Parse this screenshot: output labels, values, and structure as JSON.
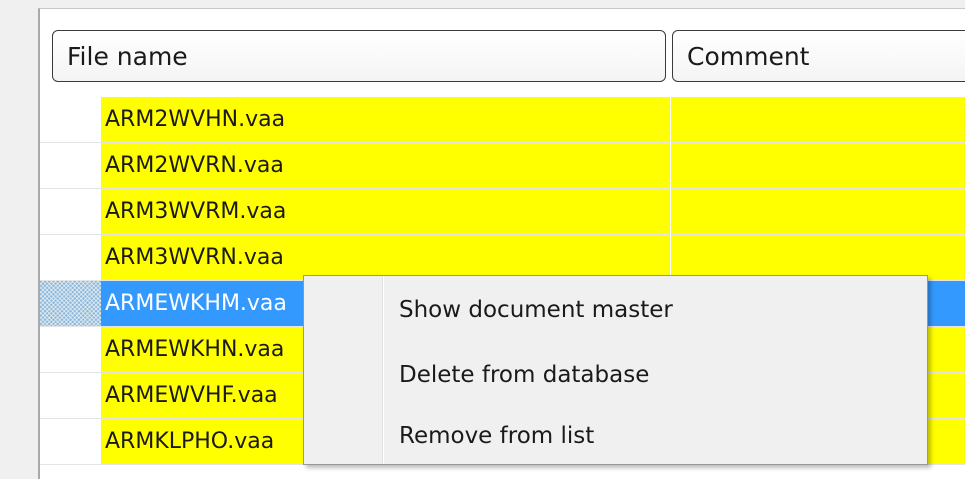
{
  "columns": {
    "file_name": "File name",
    "comment": "Comment"
  },
  "rows": [
    {
      "file_name": "ARM2WVHN.vaa",
      "comment": ""
    },
    {
      "file_name": "ARM2WVRN.vaa",
      "comment": ""
    },
    {
      "file_name": "ARM3WVRM.vaa",
      "comment": ""
    },
    {
      "file_name": "ARM3WVRN.vaa",
      "comment": ""
    },
    {
      "file_name": "ARMEWKHM.vaa",
      "comment": "",
      "selected": true
    },
    {
      "file_name": "ARMEWKHN.vaa",
      "comment": ""
    },
    {
      "file_name": "ARMEWVHF.vaa",
      "comment": ""
    },
    {
      "file_name": "ARMKLPHO.vaa",
      "comment": ""
    }
  ],
  "context_menu": {
    "items": [
      "Show document master",
      "Delete from database",
      "Remove from list"
    ]
  },
  "colors": {
    "row_highlight": "#ffff00",
    "selection": "#3399ff"
  }
}
